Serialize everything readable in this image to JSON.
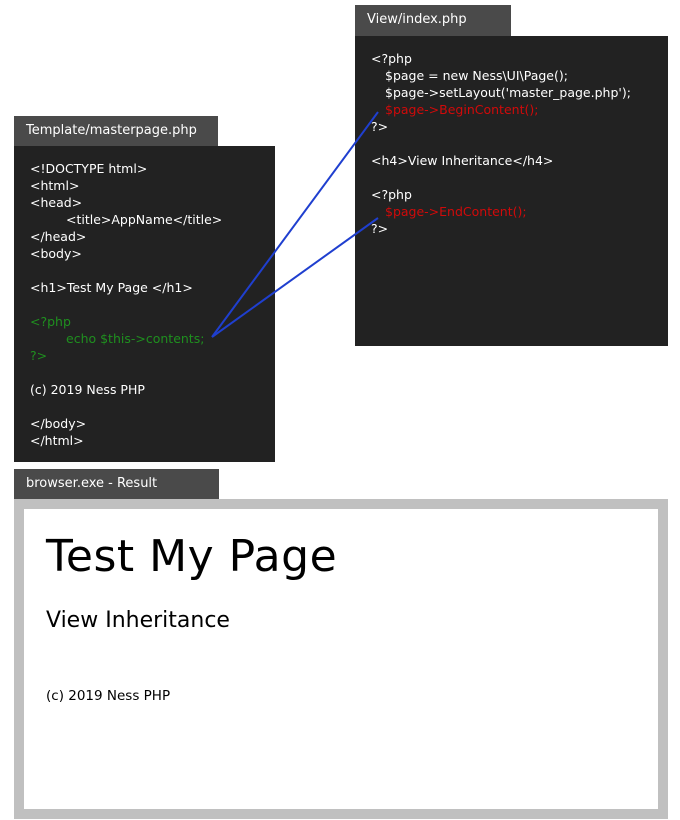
{
  "master_template": {
    "tab_label": "Template/masterpage.php",
    "lines": [
      {
        "text": "<!DOCTYPE html>",
        "style": "normal",
        "indent": 0
      },
      {
        "text": "<html>",
        "style": "normal",
        "indent": 0
      },
      {
        "text": "<head>",
        "style": "normal",
        "indent": 0
      },
      {
        "text": "<title>AppName</title>",
        "style": "normal",
        "indent": 2
      },
      {
        "text": "</head>",
        "style": "normal",
        "indent": 0
      },
      {
        "text": "<body>",
        "style": "normal",
        "indent": 0
      },
      {
        "text": "",
        "style": "normal",
        "indent": 0
      },
      {
        "text": "<h1>Test My Page </h1>",
        "style": "normal",
        "indent": 0
      },
      {
        "text": "",
        "style": "normal",
        "indent": 0
      },
      {
        "text": "<?php",
        "style": "green",
        "indent": 0
      },
      {
        "text": "echo $this->contents;",
        "style": "green",
        "indent": 2
      },
      {
        "text": "?>",
        "style": "green",
        "indent": 0
      },
      {
        "text": "",
        "style": "normal",
        "indent": 0
      },
      {
        "text": "(c) 2019 Ness PHP",
        "style": "normal",
        "indent": 0
      },
      {
        "text": "",
        "style": "normal",
        "indent": 0
      },
      {
        "text": "</body>",
        "style": "normal",
        "indent": 0
      },
      {
        "text": "</html>",
        "style": "normal",
        "indent": 0
      }
    ]
  },
  "view_index": {
    "tab_label": "View/index.php",
    "lines": [
      {
        "text": "<?php",
        "style": "normal",
        "indent": 0
      },
      {
        "text": "$page = new Ness\\UI\\Page();",
        "style": "normal",
        "indent": 1
      },
      {
        "text": "$page->setLayout('master_page.php');",
        "style": "normal",
        "indent": 1
      },
      {
        "text": "$page->BeginContent();",
        "style": "red",
        "indent": 1
      },
      {
        "text": "?>",
        "style": "normal",
        "indent": 0
      },
      {
        "text": "",
        "style": "normal",
        "indent": 0
      },
      {
        "text": "<h4>View Inheritance</h4>",
        "style": "normal",
        "indent": 0
      },
      {
        "text": "",
        "style": "normal",
        "indent": 0
      },
      {
        "text": "<?php",
        "style": "normal",
        "indent": 0
      },
      {
        "text": "$page->EndContent();",
        "style": "red",
        "indent": 1
      },
      {
        "text": "?>",
        "style": "normal",
        "indent": 0
      }
    ]
  },
  "browser": {
    "tab_label": "browser.exe - Result",
    "h1": "Test My Page",
    "h4": "View Inheritance",
    "footer": "(c) 2019 Ness PHP"
  },
  "colors": {
    "tab_bg": "#4a4a4a",
    "code_bg": "#222222",
    "php_green": "#1f8f1f",
    "php_red": "#d10a0a",
    "connector_blue": "#1f3fcf",
    "browser_frame": "#c0c0c0"
  }
}
